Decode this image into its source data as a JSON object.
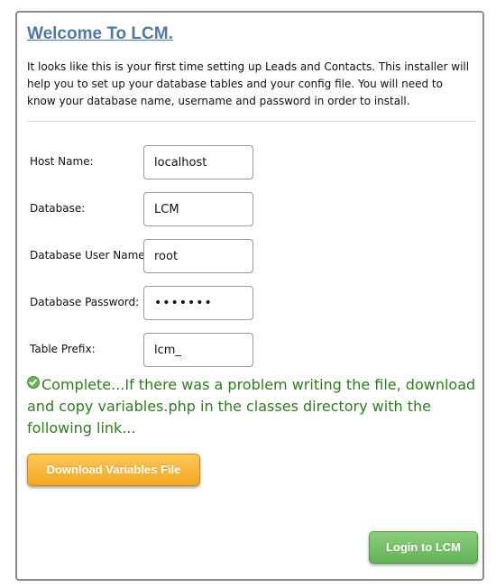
{
  "header": {
    "title": "Welcome To LCM."
  },
  "intro": {
    "text": "It looks like this is your first time setting up Leads and Contacts. This installer will help you to set up your database tables and your config file. You will need to know your database name, username and password in order to install."
  },
  "form": {
    "host": {
      "label": "Host Name:",
      "value": "localhost"
    },
    "database": {
      "label": "Database:",
      "value": "LCM"
    },
    "user": {
      "label": "Database User Name:",
      "value": "root"
    },
    "password": {
      "label": "Database Password:",
      "value": "•••••••"
    },
    "prefix": {
      "label": "Table Prefix:",
      "value": "lcm_"
    }
  },
  "status": {
    "icon": "check-circle-icon",
    "text": "Complete...If there was a problem writing the file, download and copy variables.php in the classes directory with the following link...",
    "color": "#2e7d1e"
  },
  "actions": {
    "download_label": "Download Variables File",
    "login_label": "Login to LCM"
  },
  "colors": {
    "title": "#4f7aa8",
    "download_button": "#f4a722",
    "login_button": "#65b255"
  }
}
